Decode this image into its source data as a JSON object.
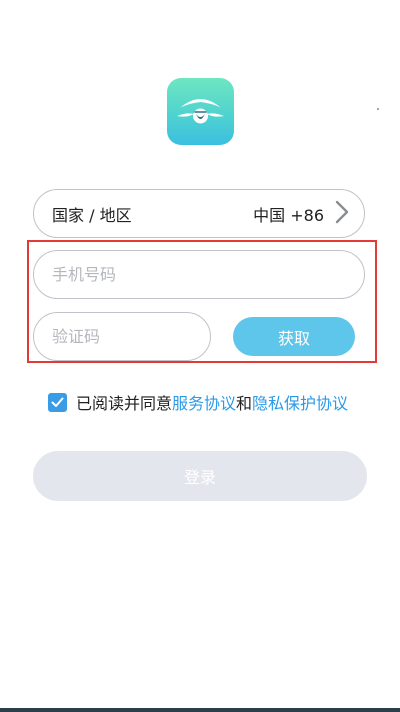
{
  "logo": {
    "icon": "app-logo-icon"
  },
  "region": {
    "label": "国家 / 地区",
    "value": "中国 +86",
    "icon": "chevron-right-icon"
  },
  "phone_input": {
    "placeholder": "手机号码",
    "value": ""
  },
  "code_input": {
    "placeholder": "验证码",
    "value": ""
  },
  "get_code_button": {
    "label": "获取"
  },
  "agreement": {
    "checked": true,
    "prefix": "已阅读并同意",
    "service_link": "服务协议",
    "and_text": "和",
    "privacy_link": "隐私保护协议"
  },
  "login_button": {
    "label": "登录"
  },
  "colors": {
    "accent": "#5ec6ea",
    "link": "#2b9ae6",
    "checkbox": "#3b9ce6",
    "highlight": "#e53935",
    "disabled_button": "#e4e6ee"
  }
}
